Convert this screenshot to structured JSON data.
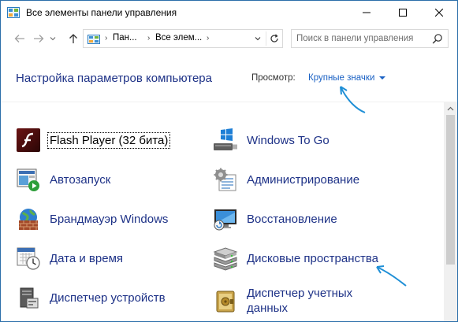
{
  "window": {
    "title": "Все элементы панели управления"
  },
  "address": {
    "crumbs": [
      "Пан...",
      "Все элем..."
    ]
  },
  "search": {
    "placeholder": "Поиск в панели управления"
  },
  "header": {
    "title": "Настройка параметров компьютера",
    "view_label": "Просмотр:",
    "view_value": "Крупные значки"
  },
  "items": {
    "left": [
      {
        "label": "Flash Player (32 бита)",
        "icon": "flash-player-icon"
      },
      {
        "label": "Автозапуск",
        "icon": "autoplay-icon"
      },
      {
        "label": "Брандмауэр Windows",
        "icon": "firewall-icon"
      },
      {
        "label": "Дата и время",
        "icon": "date-time-icon"
      },
      {
        "label": "Диспетчер устройств",
        "icon": "device-manager-icon"
      }
    ],
    "right": [
      {
        "label": "Windows To Go",
        "icon": "windows-to-go-icon"
      },
      {
        "label": "Администрирование",
        "icon": "administrative-tools-icon"
      },
      {
        "label": "Восстановление",
        "icon": "recovery-icon"
      },
      {
        "label": "Дисковые пространства",
        "icon": "storage-spaces-icon"
      },
      {
        "label": "Диспетчер учетных данных",
        "icon": "credential-manager-icon"
      }
    ]
  },
  "colors": {
    "link_text": "#1e3287",
    "accent_blue": "#1a61c4",
    "annotation_arrow": "#1f8fd6"
  }
}
